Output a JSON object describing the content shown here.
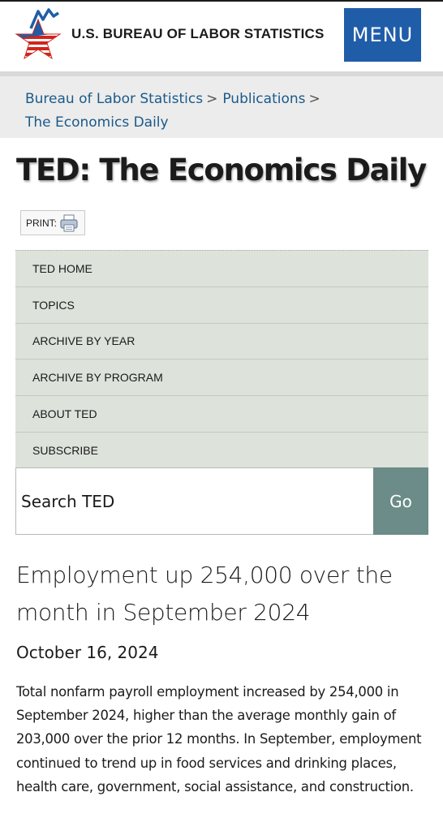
{
  "header": {
    "site_title": "U.S. BUREAU OF LABOR STATISTICS",
    "menu_label": "MENU",
    "logo_icon": "bls-star-logo-icon",
    "colors": {
      "menu_bg": "#1f5da8",
      "logo_red": "#d0251c",
      "logo_blue": "#1f5da8"
    }
  },
  "breadcrumb": {
    "items": [
      "Bureau of Labor Statistics",
      "Publications",
      "The Economics Daily"
    ],
    "separator": ">"
  },
  "page": {
    "title": "TED: The Economics Daily",
    "print_label": "PRINT:",
    "print_icon": "printer-icon"
  },
  "nav": {
    "items": [
      {
        "label": "TED HOME"
      },
      {
        "label": "TOPICS"
      },
      {
        "label": "ARCHIVE BY YEAR"
      },
      {
        "label": "ARCHIVE BY PROGRAM"
      },
      {
        "label": "ABOUT TED"
      },
      {
        "label": "SUBSCRIBE"
      }
    ],
    "colors": {
      "bg": "#dde2da"
    }
  },
  "search": {
    "placeholder": "Search TED",
    "button_label": "Go",
    "colors": {
      "button_bg": "#6b8c88"
    }
  },
  "article": {
    "title": "Employment up 254,000 over the month in September 2024",
    "date": "October 16, 2024",
    "body": "Total nonfarm payroll employment increased by 254,000 in September 2024, higher than the average monthly gain of 203,000 over the prior 12 months. In September, employment continued to trend up in food services and drinking places, health care, government, social assistance, and construction."
  }
}
